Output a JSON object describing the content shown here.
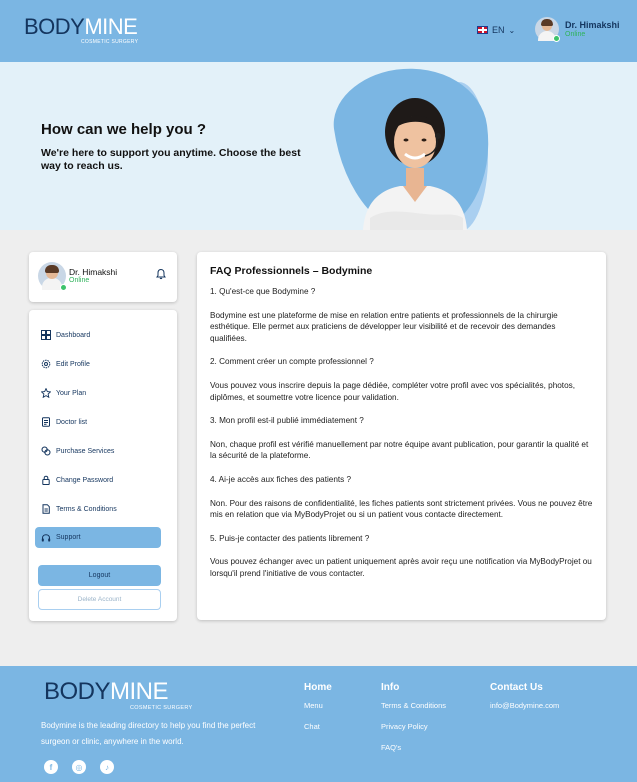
{
  "brand": {
    "logo_main_dark": "BODY",
    "logo_main_light": "MINE",
    "logo_sub": "COSMETIC SURGERY"
  },
  "header": {
    "language": "EN",
    "user_name": "Dr. Himakshi",
    "user_status": "Online"
  },
  "hero": {
    "title": "How can we help you ?",
    "subtitle": "We're here to support you anytime. Choose the best way to reach us."
  },
  "sidebar": {
    "user_name": "Dr. Himakshi",
    "user_status": "Online",
    "items": [
      {
        "label": "Dashboard",
        "icon": "dashboard-icon"
      },
      {
        "label": "Edit Profile",
        "icon": "gear-icon"
      },
      {
        "label": "Your Plan",
        "icon": "star-icon"
      },
      {
        "label": "Doctor list",
        "icon": "doctor-list-icon"
      },
      {
        "label": "Purchase Services",
        "icon": "purchase-icon"
      },
      {
        "label": "Change Password",
        "icon": "lock-icon"
      },
      {
        "label": "Terms & Conditions",
        "icon": "document-icon"
      },
      {
        "label": "Support",
        "icon": "headset-icon",
        "active": true
      }
    ],
    "logout_label": "Logout",
    "delete_label": "Delete Account"
  },
  "faq": {
    "title": "FAQ Professionnels – Bodymine",
    "items": [
      {
        "q": "1. Qu'est-ce que Bodymine ?",
        "a": "Bodymine est une plateforme de mise en relation entre patients et professionnels de la chirurgie esthétique. Elle permet aux praticiens de développer leur visibilité et de recevoir des demandes qualifiées."
      },
      {
        "q": "2. Comment créer un compte professionnel ?",
        "a": "Vous pouvez vous inscrire depuis la page dédiée, compléter votre profil avec vos spécialités, photos, diplômes, et soumettre votre licence pour validation."
      },
      {
        "q": "3. Mon profil est-il publié immédiatement ?",
        "a": "Non, chaque profil est vérifié manuellement par notre équipe avant publication, pour garantir la qualité et la sécurité de la plateforme."
      },
      {
        "q": "4. Ai-je accès aux fiches des patients ?",
        "a": "Non. Pour des raisons de confidentialité, les fiches patients sont strictement privées. Vous ne pouvez être mis en relation que via MyBodyProjet ou si un patient vous contacte directement."
      },
      {
        "q": "5. Puis-je contacter des patients librement ?",
        "a": "Vous pouvez échanger avec un patient uniquement après avoir reçu une notification via MyBodyProjet ou lorsqu'il prend l'initiative de vous contacter."
      }
    ]
  },
  "footer": {
    "description": "Bodymine is the leading directory to help you find the perfect surgeon or clinic, anywhere in the world.",
    "home": {
      "title": "Home",
      "links": [
        "Menu",
        "Chat"
      ]
    },
    "info": {
      "title": "Info",
      "links": [
        "Terms & Conditions",
        "Privacy Policy",
        "FAQ's"
      ]
    },
    "contact": {
      "title": "Contact Us",
      "email": "info@Bodymine.com"
    },
    "social": [
      {
        "icon": "facebook-icon",
        "glyph": "f"
      },
      {
        "icon": "instagram-icon",
        "glyph": "◎"
      },
      {
        "icon": "tiktok-icon",
        "glyph": "♪"
      }
    ]
  },
  "colors": {
    "primary": "#7bb6e3",
    "navy": "#14355e",
    "hero_bg": "#e3f1f9",
    "online": "#2fb35b"
  }
}
